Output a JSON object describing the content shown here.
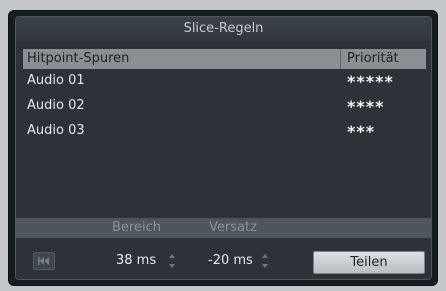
{
  "window": {
    "title": "Slice-Regeln"
  },
  "table": {
    "headers": [
      "Hitpoint-Spuren",
      "Priorität"
    ],
    "rows": [
      {
        "name": "Audio 01",
        "priority": "*****"
      },
      {
        "name": "Audio 02",
        "priority": "****"
      },
      {
        "name": "Audio 03",
        "priority": "***"
      }
    ]
  },
  "controls": {
    "bereich_label": "Bereich",
    "versatz_label": "Versatz",
    "bereich_value": "38 ms",
    "versatz_value": "-20 ms",
    "teilen_label": "Teilen",
    "skip_icon": "skip-to-start-icon"
  }
}
